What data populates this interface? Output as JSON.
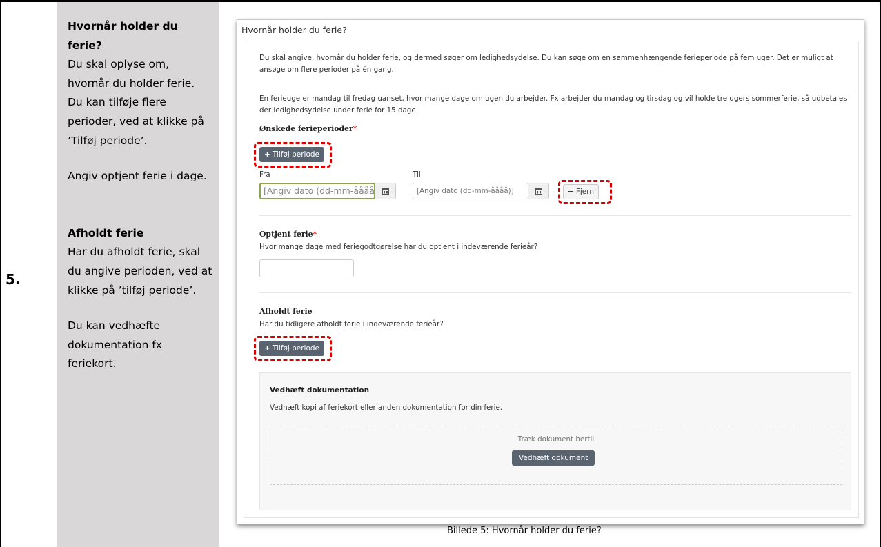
{
  "step_number": "5.",
  "sidebar": {
    "heading1": "Hvornår holder du ferie?",
    "para1": "Du skal oplyse om, hvornår du holder ferie. Du kan tilføje flere perioder, ved at klikke på ’Tilføj periode’.",
    "para2": "Angiv optjent ferie i dage.",
    "heading2": "Afholdt ferie",
    "para3": "Har du afholdt ferie, skal du angive perioden, ved at klikke på ’tilføj periode’.",
    "para4": "Du kan vedhæfte dokumentation fx feriekort."
  },
  "screenshot": {
    "title": "Hvornår holder du ferie?",
    "intro1": "Du skal angive, hvornår du holder ferie, og dermed søger om ledighedsydelse. Du kan søge om en sammenhængende ferieperiode på fem uger. Det er muligt at ansøge om flere perioder på én gang.",
    "intro2": "En ferieuge er mandag til fredag uanset, hvor mange dage om ugen du arbejder. Fx arbejder du mandag og tirsdag og vil holde tre ugers sommerferie, så udbetales der ledighedsydelse under ferie for 15 dage.",
    "periods_label": "Ønskede ferieperioder",
    "required_mark": "*",
    "add_period_button": "Tilføj periode",
    "from_label": "Fra",
    "to_label": "Til",
    "from_placeholder": "[Angiv dato (dd-mm-åååå)]",
    "to_placeholder": "[Angiv dato (dd-mm-åååå)]",
    "remove_button": "Fjern",
    "earned_label": "Optjent ferie",
    "earned_question": "Hvor mange dage med feriegodtgørelse har du optjent i indeværende ferieår?",
    "earned_value": "",
    "taken_label": "Afholdt ferie",
    "taken_question": "Har du tidligere afholdt ferie i indeværende ferieår?",
    "taken_add_button": "Tilføj periode",
    "attach_heading": "Vedhæft dokumentation",
    "attach_text": "Vedhæft kopi af feriekort eller anden dokumentation for din ferie.",
    "drop_text": "Træk dokument hertil",
    "attach_button": "Vedhæft dokument"
  },
  "caption": "Billede 5: Hvornår holder du ferie?",
  "colors": {
    "button_bg": "#5a6370",
    "highlight": "#d60000",
    "sidebar_bg": "#d9d7d7",
    "focus_border": "#8fa352"
  }
}
